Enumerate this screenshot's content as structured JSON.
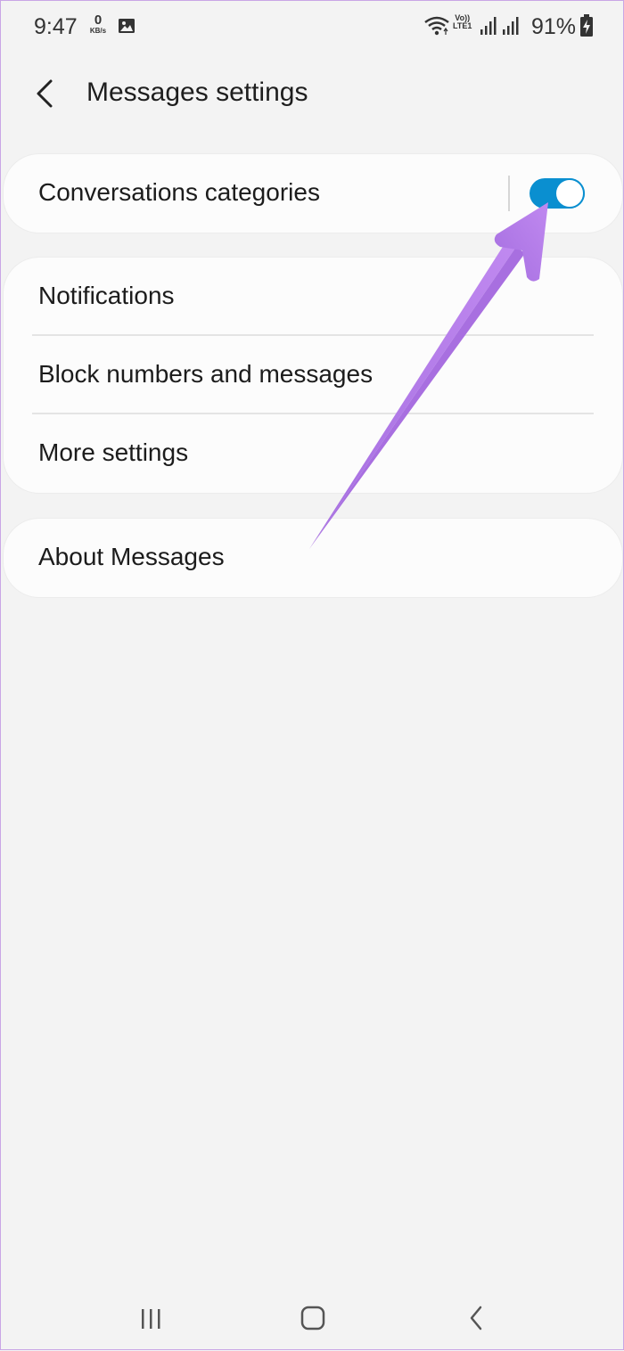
{
  "status_bar": {
    "time": "9:47",
    "net_speed_value": "0",
    "net_speed_unit": "KB/s",
    "volte_top": "Vo))",
    "volte_bottom": "LTE1",
    "battery": "91%"
  },
  "header": {
    "title": "Messages settings"
  },
  "settings": {
    "conversations_categories": {
      "label": "Conversations categories",
      "enabled": true
    },
    "group": [
      {
        "label": "Notifications"
      },
      {
        "label": "Block numbers and messages"
      },
      {
        "label": "More settings"
      }
    ],
    "about": {
      "label": "About Messages"
    }
  },
  "colors": {
    "toggle_on": "#0a8fd0",
    "annotation_arrow": "#b57ae8",
    "background": "#f3f3f3"
  },
  "icons": {
    "back": "chevron-left-icon",
    "gallery": "image-icon",
    "wifi": "wifi-icon",
    "signal": "signal-bars-icon",
    "battery": "battery-charging-icon",
    "nav_recents": "recents-icon",
    "nav_home": "home-icon",
    "nav_back": "back-icon"
  }
}
